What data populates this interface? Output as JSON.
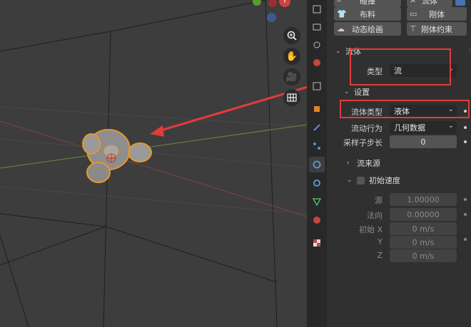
{
  "colors": {
    "viewport_bg": "#3d3d3d",
    "panel_bg": "#303030",
    "field_bg": "#282828",
    "button_bg": "#545454",
    "annotation_red": "#e23b3b",
    "selection_orange": "#e8972a"
  },
  "viewport": {
    "nav_icons": [
      "zoom-icon",
      "hand-icon",
      "camera-icon",
      "grid-icon"
    ],
    "gizmo_axis_label": "Y"
  },
  "tabs": [
    "tool-icon",
    "render-icon",
    "output-icon",
    "view-layer-icon",
    "scene-icon",
    "world-icon",
    "collection-icon",
    "object-icon",
    "modifier-icon",
    "particles-icon",
    "physics-icon",
    "constraints-icon",
    "data-icon",
    "material-icon",
    "texture-icon"
  ],
  "physics_buttons": [
    {
      "label": "碰撞",
      "icon": "collision-icon"
    },
    {
      "label": "流体",
      "icon": "close-icon"
    },
    {
      "label": "布料",
      "icon": "cloth-icon"
    },
    {
      "label": "刚体",
      "icon": "rigid-body-icon"
    },
    {
      "label": "动态绘画",
      "icon": "dynamic-paint-icon"
    },
    {
      "label": "刚体约束",
      "icon": "rigid-constraint-icon"
    }
  ],
  "fluid_panel": {
    "title": "流体",
    "type_label": "类型",
    "type_value": "流"
  },
  "settings_panel": {
    "title": "设置",
    "flow_type_label": "流体类型",
    "flow_type_value": "液体",
    "flow_behavior_label": "流动行为",
    "flow_behavior_value": "几何数据",
    "substeps_label": "采样子步长",
    "substeps_value": "0"
  },
  "flow_source": {
    "title": "流来源"
  },
  "initial_velocity": {
    "title": "初始速度",
    "source_label": "源",
    "source_value": "1.00000",
    "normal_label": "法向",
    "normal_value": "0.00000",
    "x_label": "初始 X",
    "x_value": "0 m/s",
    "y_label": "Y",
    "y_value": "0 m/s",
    "z_label": "Z",
    "z_value": "0 m/s"
  }
}
